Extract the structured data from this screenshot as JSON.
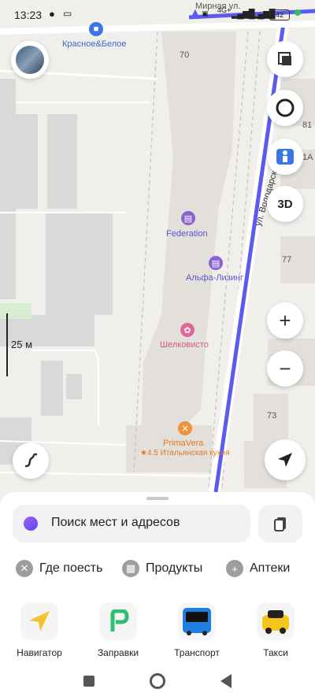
{
  "status_bar": {
    "time": "13:23",
    "street_top": "Мирная ул.",
    "network": "4G+",
    "battery": "42"
  },
  "map": {
    "pois": [
      {
        "name": "Красное&Белое",
        "icon": "shopping-bag-icon",
        "color": "#3a76e6"
      },
      {
        "name": "Federation",
        "icon": "briefcase-icon",
        "color": "#8a63d2"
      },
      {
        "name": "Альфа-Лизинг",
        "icon": "briefcase-icon",
        "color": "#8a63d2"
      },
      {
        "name": "Шелковисто",
        "icon": "flower-icon",
        "color": "#e0679a"
      },
      {
        "name": "PrimaVera",
        "icon": "fork-knife-icon",
        "color": "#f0933a"
      }
    ],
    "primavera_rating": "★4.5 Итальянская кухня",
    "street_name": "ул. Володарского",
    "house_numbers": [
      "70",
      "81",
      "1А",
      "77",
      "73"
    ],
    "scale": "25 м",
    "route_color": "#5b5bf0"
  },
  "controls": {
    "three_d": "3D",
    "zoom_in": "+",
    "zoom_out": "−"
  },
  "search": {
    "placeholder": "Поиск мест и адресов"
  },
  "chips": [
    {
      "label": "Где поесть",
      "icon": "fork-knife-icon"
    },
    {
      "label": "Продукты",
      "icon": "basket-icon"
    },
    {
      "label": "Аптеки",
      "icon": "plus-icon"
    }
  ],
  "services": [
    {
      "label": "Навигатор",
      "icon": "navigator-arrow-icon"
    },
    {
      "label": "Заправки",
      "icon": "fuel-icon"
    },
    {
      "label": "Транспорт",
      "icon": "bus-icon"
    },
    {
      "label": "Такси",
      "icon": "taxi-icon"
    }
  ]
}
